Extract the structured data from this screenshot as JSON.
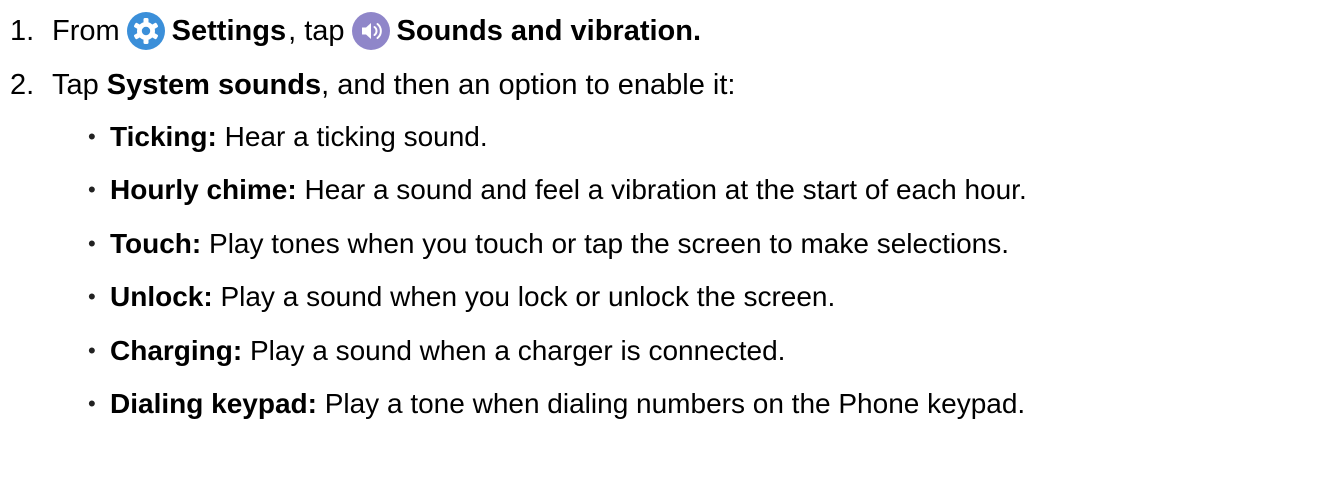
{
  "steps": [
    {
      "number": "1.",
      "prefix": "From",
      "settings_label": "Settings",
      "mid": ", tap",
      "sounds_label": "Sounds and vibration.",
      "icons": [
        "settings-gear-icon",
        "volume-icon"
      ],
      "colors": {
        "settings_icon": "#3b8fd9",
        "sounds_icon": "#8f86c9"
      }
    },
    {
      "number": "2.",
      "prefix": "Tap",
      "system_label": "System sounds",
      "suffix": ", and then an option to enable it:"
    }
  ],
  "options": [
    {
      "term": "Ticking:",
      "desc": " Hear a ticking sound."
    },
    {
      "term": "Hourly chime:",
      "desc": " Hear a sound and feel a vibration at the start of each hour."
    },
    {
      "term": "Touch:",
      "desc": " Play tones when you touch or tap the screen to make selections."
    },
    {
      "term": "Unlock:",
      "desc": " Play a sound when you lock or unlock the screen."
    },
    {
      "term": "Charging:",
      "desc": " Play a sound when a charger is connected."
    },
    {
      "term": "Dialing keypad:",
      "desc": " Play a tone when dialing numbers on the Phone keypad."
    }
  ],
  "bullet_char": "•"
}
